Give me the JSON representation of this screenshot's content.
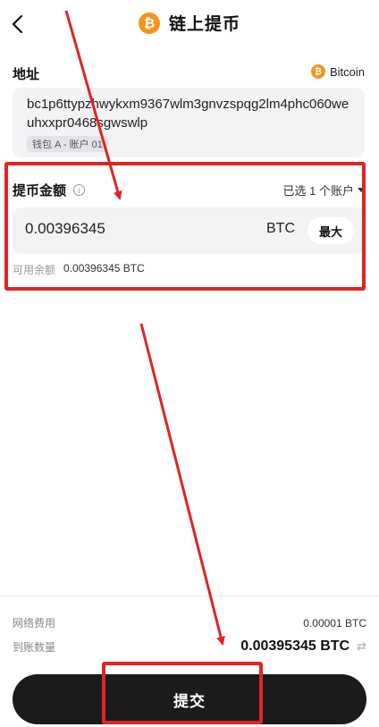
{
  "header": {
    "title": "链上提币",
    "coin_symbol": "₿"
  },
  "address": {
    "label": "地址",
    "coin_name": "Bitcoin",
    "value": "bc1p6ttyp​zhwykxm9367wlm3gnvzspqg2lm4phc060weuhxxpr0468sgwswlp",
    "wallet_tag": "钱包 A - 账户 01"
  },
  "amount": {
    "label": "提币金额",
    "account_selector": "已选 1 个账户",
    "value": "0.00396345",
    "unit": "BTC",
    "max_label": "最大",
    "available_label": "可用余额",
    "available_value": "0.00396345 BTC"
  },
  "summary": {
    "fee_label": "网络费用",
    "fee_value": "0.00001 BTC",
    "received_label": "到账数量",
    "received_value": "0.00395345 BTC"
  },
  "submit_label": "提交",
  "colors": {
    "accent": "#1b1b1b",
    "btc": "#f7931a",
    "annotation_red": "#e02424"
  }
}
